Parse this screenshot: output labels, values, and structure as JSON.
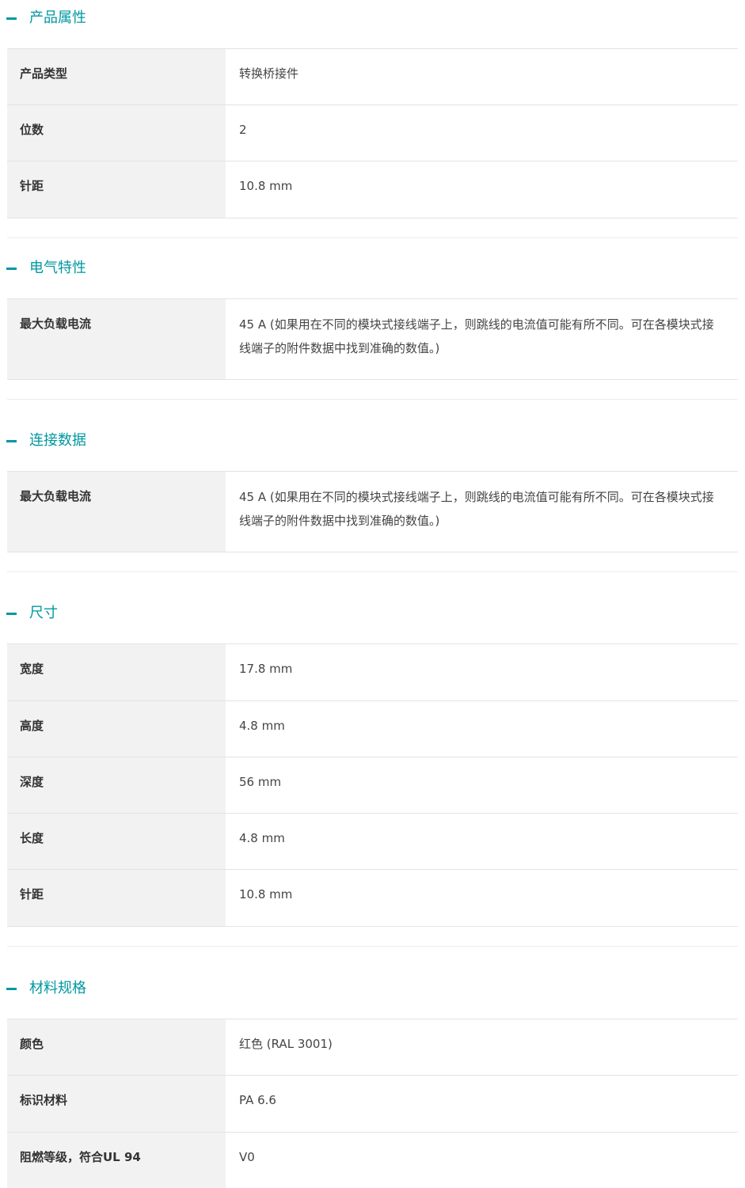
{
  "sections": [
    {
      "title": "产品属性",
      "rows": [
        {
          "label": "产品类型",
          "value": "转换桥接件"
        },
        {
          "label": "位数",
          "value": "2"
        },
        {
          "label": "针距",
          "value": "10.8 mm"
        }
      ]
    },
    {
      "title": "电气特性",
      "rows": [
        {
          "label": "最大负载电流",
          "value": "45 A (如果用在不同的模块式接线端子上，则跳线的电流值可能有所不同。可在各模块式接线端子的附件数据中找到准确的数值。)"
        }
      ]
    },
    {
      "title": "连接数据",
      "rows": [
        {
          "label": "最大负载电流",
          "value": "45 A (如果用在不同的模块式接线端子上，则跳线的电流值可能有所不同。可在各模块式接线端子的附件数据中找到准确的数值。)"
        }
      ]
    },
    {
      "title": "尺寸",
      "rows": [
        {
          "label": "宽度",
          "value": "17.8 mm"
        },
        {
          "label": "高度",
          "value": "4.8 mm"
        },
        {
          "label": "深度",
          "value": "56 mm"
        },
        {
          "label": "长度",
          "value": "4.8 mm"
        },
        {
          "label": "针距",
          "value": "10.8 mm"
        }
      ]
    },
    {
      "title": "材料规格",
      "rows": [
        {
          "label": "颜色",
          "value": "红色 (RAL 3001)"
        },
        {
          "label": "标识材料",
          "value": "PA 6.6"
        },
        {
          "label": "阻燃等级，符合UL 94",
          "value": "V0"
        }
      ]
    }
  ],
  "colors": {
    "accent": "#0098a1",
    "label_bg": "#f2f2f2",
    "border": "#e3e3e3"
  },
  "icons": {
    "toggle": "collapse-minus-icon"
  }
}
